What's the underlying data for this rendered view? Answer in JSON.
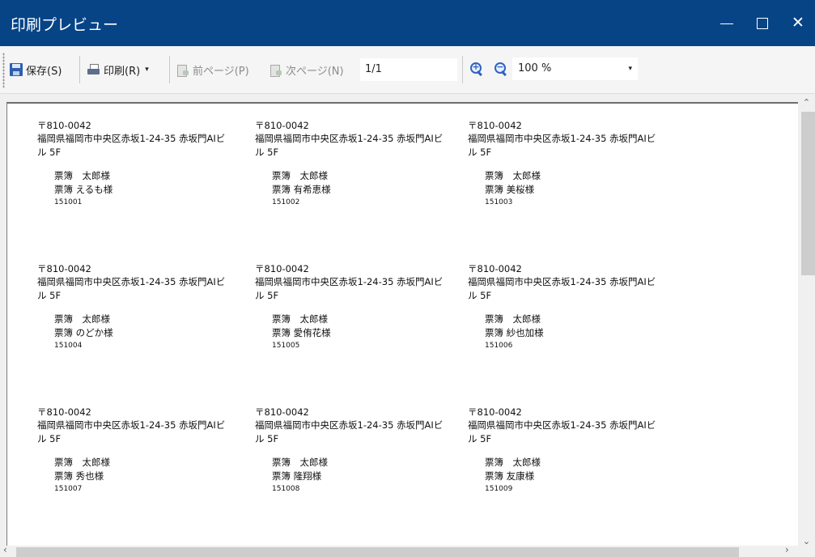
{
  "window": {
    "title": "印刷プレビュー",
    "minimize_icon": "minimize-icon",
    "maximize_icon": "maximize-icon",
    "close_icon": "close-icon",
    "close_glyph": "✕",
    "titlebar_color": "#064486"
  },
  "toolbar": {
    "save_label": "保存(S)",
    "print_label": "印刷(R)",
    "prev_label": "前ページ(P)",
    "next_label": "次ページ(N)",
    "page_value": "1/1",
    "zoom_value": "100 %",
    "dropdown_glyph": "▾"
  },
  "labels": [
    {
      "zip": "〒810-0042",
      "addr": "福岡県福岡市中央区赤坂1-24-35 赤坂門AIビル 5F",
      "name1": "票簿　太郎様",
      "name2": "票簿 えるも様",
      "code": "151001"
    },
    {
      "zip": "〒810-0042",
      "addr": "福岡県福岡市中央区赤坂1-24-35 赤坂門AIビル 5F",
      "name1": "票簿　太郎様",
      "name2": "票簿 有希恵様",
      "code": "151002"
    },
    {
      "zip": "〒810-0042",
      "addr": "福岡県福岡市中央区赤坂1-24-35 赤坂門AIビル 5F",
      "name1": "票簿　太郎様",
      "name2": "票簿 美桜様",
      "code": "151003"
    },
    {
      "zip": "〒810-0042",
      "addr": "福岡県福岡市中央区赤坂1-24-35 赤坂門AIビル 5F",
      "name1": "票簿　太郎様",
      "name2": "票簿 のどか様",
      "code": "151004"
    },
    {
      "zip": "〒810-0042",
      "addr": "福岡県福岡市中央区赤坂1-24-35 赤坂門AIビル 5F",
      "name1": "票簿　太郎様",
      "name2": "票簿 愛侑花様",
      "code": "151005"
    },
    {
      "zip": "〒810-0042",
      "addr": "福岡県福岡市中央区赤坂1-24-35 赤坂門AIビル 5F",
      "name1": "票簿　太郎様",
      "name2": "票簿 紗也加様",
      "code": "151006"
    },
    {
      "zip": "〒810-0042",
      "addr": "福岡県福岡市中央区赤坂1-24-35 赤坂門AIビル 5F",
      "name1": "票簿　太郎様",
      "name2": "票簿 秀也様",
      "code": "151007"
    },
    {
      "zip": "〒810-0042",
      "addr": "福岡県福岡市中央区赤坂1-24-35 赤坂門AIビル 5F",
      "name1": "票簿　太郎様",
      "name2": "票簿 隆翔様",
      "code": "151008"
    },
    {
      "zip": "〒810-0042",
      "addr": "福岡県福岡市中央区赤坂1-24-35 赤坂門AIビル 5F",
      "name1": "票簿　太郎様",
      "name2": "票簿 友康様",
      "code": "151009"
    }
  ]
}
